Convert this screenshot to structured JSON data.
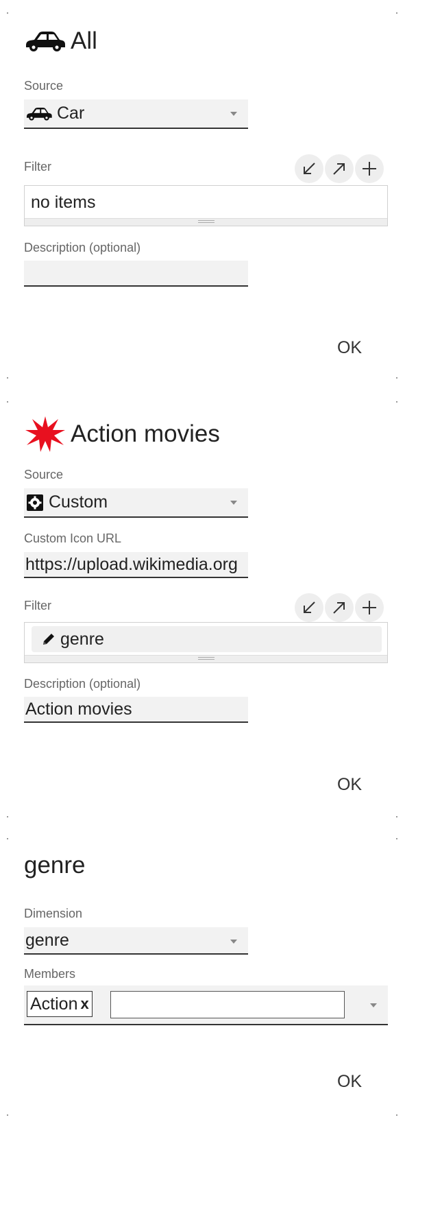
{
  "panels": [
    {
      "title": "All",
      "title_icon": "car-icon",
      "source_label": "Source",
      "source_value": "Car",
      "source_icon": "car-icon",
      "filter_label": "Filter",
      "filter_text": "no items",
      "description_label": "Description (optional)",
      "description_value": "",
      "ok_label": "OK"
    },
    {
      "title": "Action movies",
      "title_icon": "explosion-icon",
      "source_label": "Source",
      "source_value": "Custom",
      "source_icon": "gear-box-icon",
      "custom_url_label": "Custom Icon URL",
      "custom_url_value": "https://upload.wikimedia.org",
      "filter_label": "Filter",
      "filter_chip": "genre",
      "filter_chip_icon": "pencil-icon",
      "description_label": "Description (optional)",
      "description_value": "Action movies",
      "ok_label": "OK"
    },
    {
      "title": "genre",
      "dimension_label": "Dimension",
      "dimension_value": "genre",
      "members_label": "Members",
      "member_tag": "Action",
      "member_remove": "x",
      "members_input_value": "",
      "ok_label": "OK"
    }
  ],
  "toolbar_icons": [
    "collapse-arrow-icon",
    "expand-arrow-icon",
    "plus-icon"
  ],
  "colors": {
    "accent_red": "#e8101f",
    "text": "#222222",
    "muted": "#666666",
    "field_bg": "#f2f2f2"
  }
}
